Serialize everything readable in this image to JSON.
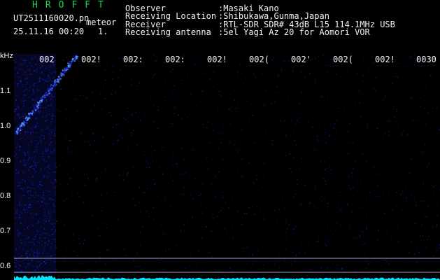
{
  "app": {
    "logo": "HROFFT",
    "filename": "UT2511160020.pn",
    "mode": "meteor",
    "timestamp": "25.11.16 00:20",
    "channel": "1."
  },
  "info": [
    {
      "label": "Observer",
      "value": ":Masaki Kano"
    },
    {
      "label": "Receiving Location",
      "value": ":Shibukawa,Gunma,Japan"
    },
    {
      "label": "Receiver",
      "value": ":RTL-SDR SDR# 43dB L15 114.1MHz USB"
    },
    {
      "label": "Receiving antenna",
      "value": ":5el Yagi Az 20 for Aomori VOR"
    }
  ],
  "spectrogram": {
    "y_unit": "kHz",
    "y_ticks": [
      "1.1",
      "1.0",
      "0.9",
      "0.8",
      "0.7",
      "0.6"
    ],
    "x_ticks": [
      "002",
      "002!",
      "002:",
      "002:",
      "002!",
      "002(",
      "002'",
      "002(",
      "002!",
      "0030"
    ],
    "colors": {
      "background": "#000000",
      "noise": "#1a22c8",
      "signal": "#5aa0ff",
      "baseline": "#00e5ff",
      "guide": "#9aa6c8"
    }
  }
}
